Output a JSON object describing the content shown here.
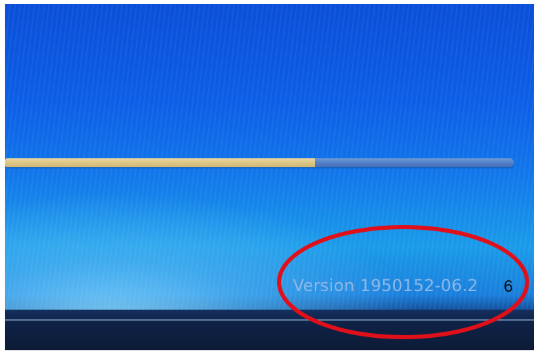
{
  "screen": {
    "progress": {
      "fraction": 0.61,
      "fill_color": "#dcc585",
      "track_color": "#4f7dc6"
    },
    "version_text": "Version 1950152-06.2"
  },
  "annotation": {
    "number": "6",
    "circle_color": "#e0101a"
  }
}
